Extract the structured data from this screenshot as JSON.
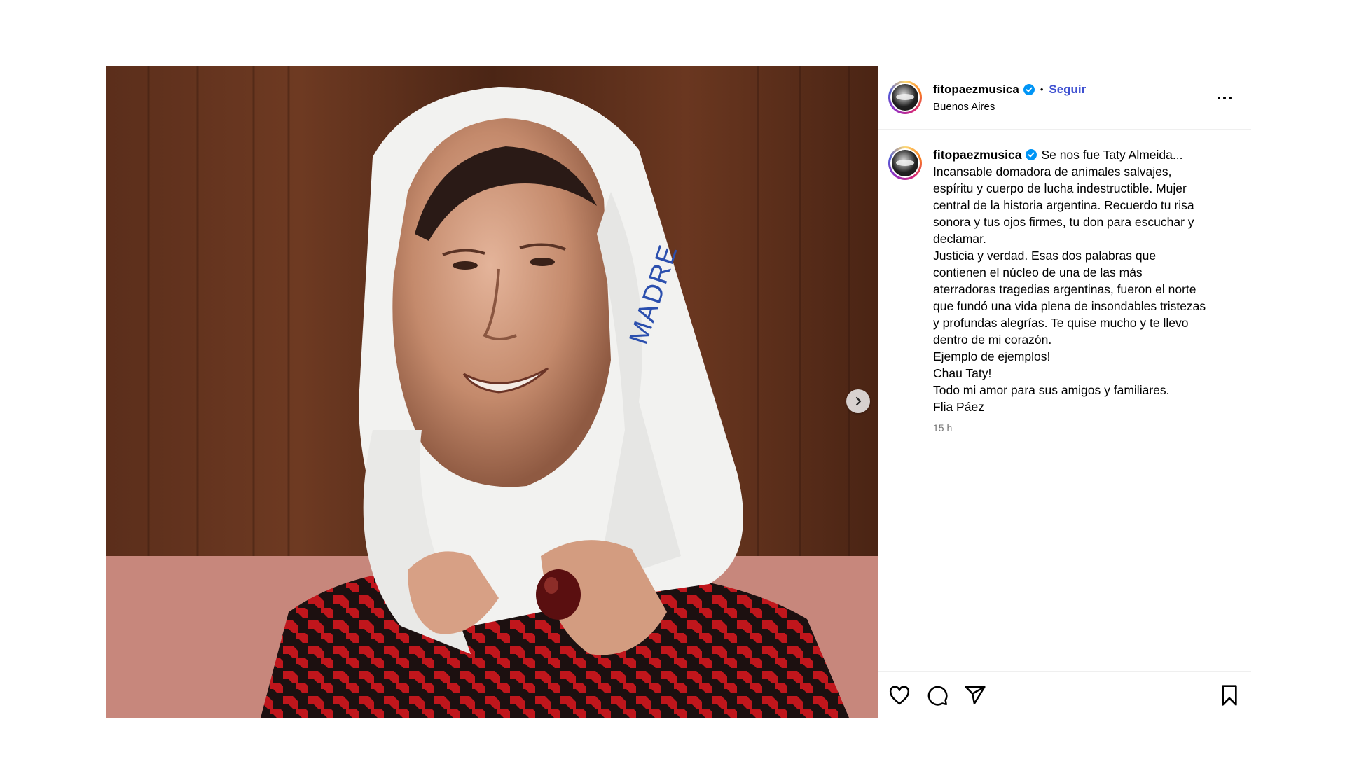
{
  "post": {
    "username": "fitopaezmusica",
    "follow_label": "Seguir",
    "location": "Buenos Aires",
    "caption_lines": [
      "Se nos fue Taty Almeida...",
      "Incansable domadora de animales salvajes,",
      "espíritu y cuerpo de lucha indestructible. Mujer",
      "central de la historia argentina. Recuerdo tu risa",
      "sonora y tus ojos firmes, tu don para escuchar y",
      "declamar.",
      "Justicia y verdad. Esas dos palabras que",
      "contienen el núcleo de una de las más",
      "aterradoras tragedias argentinas, fueron el norte",
      "que fundó una vida plena de insondables tristezas",
      "y profundas alegrías. Te quise mucho y te llevo",
      "dentro de mi corazón.",
      "Ejemplo de ejemplos!",
      "Chau Taty!",
      "Todo mi amor para sus amigos y familiares.",
      "Flia Páez"
    ],
    "timestamp": "15 h",
    "scarf_text": "MADRE"
  },
  "icons": {
    "verified": "verified-badge-icon",
    "more": "more-options-icon",
    "next": "chevron-right-icon",
    "like": "heart-icon",
    "comment": "comment-icon",
    "share": "share-icon",
    "save": "bookmark-icon"
  },
  "colors": {
    "accent": "#3f51d1",
    "verified": "#0095f6",
    "muted": "#737373"
  }
}
